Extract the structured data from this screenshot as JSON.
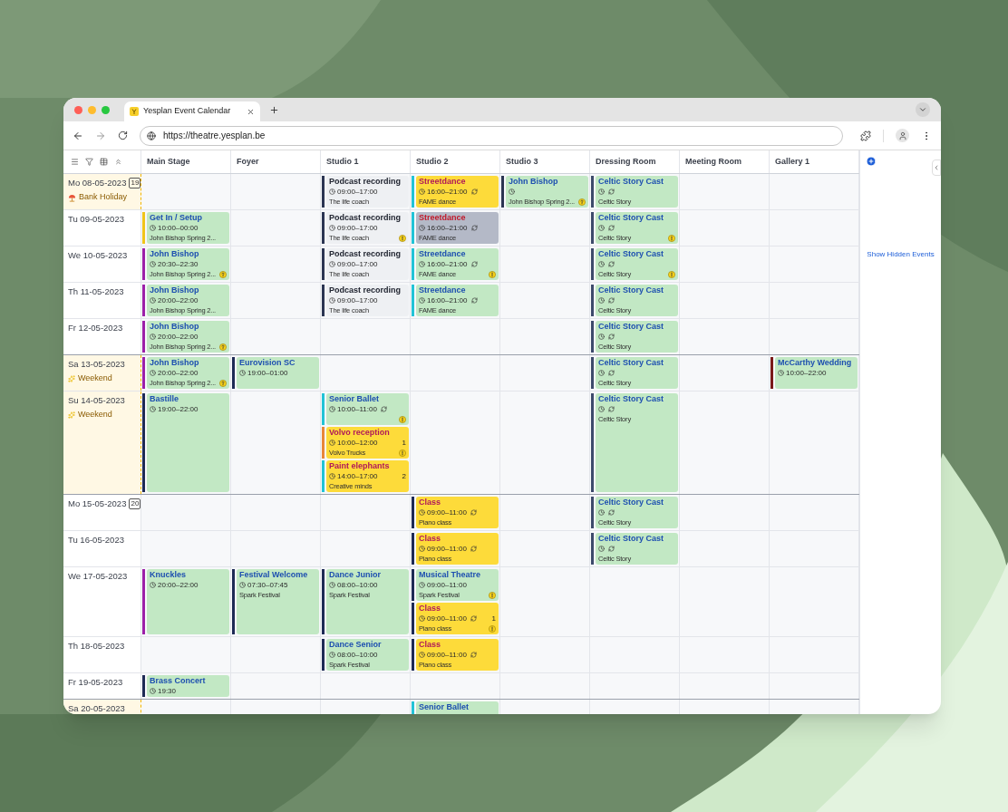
{
  "browser": {
    "tab_title": "Yesplan Event Calendar",
    "url": "https://theatre.yesplan.be"
  },
  "calendar": {
    "columns": [
      "Main Stage",
      "Foyer",
      "Studio 1",
      "Studio 2",
      "Studio 3",
      "Dressing Room",
      "Meeting Room",
      "Gallery 1"
    ],
    "show_hidden": "Show Hidden Events",
    "days": [
      {
        "date": "Mo 08-05-2023",
        "week": "19",
        "kind": "holiday",
        "note": "Bank Holiday",
        "cells": [
          [],
          [],
          [
            {
              "title": "Podcast recording",
              "time": "09:00–17:00",
              "subtitle": "The life coach",
              "kind": "draft",
              "color": "#2b3552",
              "recurring": false,
              "warning": false,
              "question": false
            }
          ],
          [
            {
              "title": "Streetdance",
              "time": "16:00–21:00",
              "subtitle": "FAME dance",
              "kind": "option",
              "color": "#22c3d6",
              "recurring": true,
              "warning": false,
              "question": false
            }
          ],
          [
            {
              "title": "John Bishop",
              "subtitle": "John Bishop Spring 2...",
              "kind": "confirmed",
              "color": "#2b3552",
              "recurring": false,
              "warning": false,
              "question": true
            }
          ],
          [
            {
              "title": "Celtic Story Cast",
              "subtitle": "Celtic Story",
              "kind": "confirmed",
              "color": "#3d4a6b",
              "recurring": true,
              "warning": false,
              "question": false
            }
          ],
          [],
          []
        ]
      },
      {
        "date": "Tu 09-05-2023",
        "kind": "weekday",
        "cells": [
          [
            {
              "title": "Get In / Setup",
              "time": "10:00–00:00",
              "subtitle": "John Bishop Spring 2...",
              "kind": "confirmed",
              "color": "#f0c419",
              "recurring": false,
              "warning": false,
              "question": false
            }
          ],
          [],
          [
            {
              "title": "Podcast recording",
              "time": "09:00–17:00",
              "subtitle": "The life coach",
              "kind": "draft",
              "color": "#2b3552",
              "recurring": false,
              "warning": true,
              "question": false
            }
          ],
          [
            {
              "title": "Streetdance",
              "time": "16:00–21:00",
              "subtitle": "FAME dance",
              "kind": "cancelled",
              "color": "#22c3d6",
              "recurring": true,
              "warning": false,
              "question": false
            }
          ],
          [],
          [
            {
              "title": "Celtic Story Cast",
              "subtitle": "Celtic Story",
              "kind": "confirmed",
              "color": "#3d4a6b",
              "recurring": true,
              "warning": true,
              "question": false
            }
          ],
          [],
          []
        ]
      },
      {
        "date": "We 10-05-2023",
        "kind": "weekday",
        "cells": [
          [
            {
              "title": "John Bishop",
              "time": "20:30–22:30",
              "subtitle": "John Bishop Spring 2...",
              "kind": "confirmed",
              "color": "#9c1fa8",
              "recurring": false,
              "warning": false,
              "question": true
            }
          ],
          [],
          [
            {
              "title": "Podcast recording",
              "time": "09:00–17:00",
              "subtitle": "The life coach",
              "kind": "draft",
              "color": "#2b3552",
              "recurring": false,
              "warning": false,
              "question": false
            }
          ],
          [
            {
              "title": "Streetdance",
              "time": "16:00–21:00",
              "subtitle": "FAME dance",
              "kind": "confirmed",
              "color": "#22c3d6",
              "recurring": true,
              "warning": true,
              "question": false
            }
          ],
          [],
          [
            {
              "title": "Celtic Story Cast",
              "subtitle": "Celtic Story",
              "kind": "confirmed",
              "color": "#3d4a6b",
              "recurring": true,
              "warning": true,
              "question": false
            }
          ],
          [],
          []
        ]
      },
      {
        "date": "Th 11-05-2023",
        "kind": "weekday",
        "cells": [
          [
            {
              "title": "John Bishop",
              "time": "20:00–22:00",
              "subtitle": "John Bishop Spring 2...",
              "kind": "confirmed",
              "color": "#9c1fa8",
              "recurring": false,
              "warning": false,
              "question": false
            }
          ],
          [],
          [
            {
              "title": "Podcast recording",
              "time": "09:00–17:00",
              "subtitle": "The life coach",
              "kind": "draft",
              "color": "#2b3552",
              "recurring": false,
              "warning": false,
              "question": false
            }
          ],
          [
            {
              "title": "Streetdance",
              "time": "16:00–21:00",
              "subtitle": "FAME dance",
              "kind": "confirmed",
              "color": "#22c3d6",
              "recurring": true,
              "warning": false,
              "question": false
            }
          ],
          [],
          [
            {
              "title": "Celtic Story Cast",
              "subtitle": "Celtic Story",
              "kind": "confirmed",
              "color": "#3d4a6b",
              "recurring": true,
              "warning": false,
              "question": false
            }
          ],
          [],
          []
        ]
      },
      {
        "date": "Fr 12-05-2023",
        "kind": "weekday",
        "cells": [
          [
            {
              "title": "John Bishop",
              "time": "20:00–22:00",
              "subtitle": "John Bishop Spring 2...",
              "kind": "confirmed",
              "color": "#9c1fa8",
              "recurring": false,
              "warning": false,
              "question": true
            }
          ],
          [],
          [],
          [],
          [],
          [
            {
              "title": "Celtic Story Cast",
              "subtitle": "Celtic Story",
              "kind": "confirmed",
              "color": "#3d4a6b",
              "recurring": true,
              "warning": false,
              "question": false
            }
          ],
          [],
          []
        ]
      },
      {
        "date": "Sa 13-05-2023",
        "kind": "weekend",
        "note": "Weekend",
        "cells": [
          [
            {
              "title": "John Bishop",
              "time": "20:00–22:00",
              "subtitle": "John Bishop Spring 2...",
              "kind": "confirmed",
              "color": "#9c1fa8",
              "recurring": false,
              "warning": false,
              "question": true
            }
          ],
          [
            {
              "title": "Eurovision SC",
              "time": "19:00–01:00",
              "kind": "confirmed",
              "color": "#1e2a55",
              "recurring": false,
              "warning": false,
              "question": false
            }
          ],
          [],
          [],
          [],
          [
            {
              "title": "Celtic Story Cast",
              "subtitle": "Celtic Story",
              "kind": "confirmed",
              "color": "#3d4a6b",
              "recurring": true,
              "warning": false,
              "question": false
            }
          ],
          [],
          [
            {
              "title": "McCarthy Wedding",
              "time": "10:00–22:00",
              "kind": "confirmed",
              "color": "#7a1a1a",
              "recurring": false,
              "warning": false,
              "question": false
            }
          ]
        ]
      },
      {
        "date": "Su 14-05-2023",
        "kind": "weekend",
        "note": "Weekend",
        "cells": [
          [
            {
              "title": "Bastille",
              "time": "19:00–22:00",
              "kind": "confirmed",
              "color": "#1e2a55",
              "recurring": false,
              "warning": false,
              "question": false
            }
          ],
          [],
          [
            {
              "title": "Senior Ballet",
              "time": "10:00–11:00",
              "kind": "confirmed",
              "color": "#22c3d6",
              "recurring": true,
              "warning": true,
              "question": false
            },
            {
              "title": "Volvo reception",
              "time": "10:00–12:00",
              "subtitle": "Volvo Trucks",
              "kind": "option",
              "color": "#e8873a",
              "recurring": false,
              "count": "1",
              "warning": true,
              "question": false
            },
            {
              "title": "Paint elephants",
              "time": "14:00–17:00",
              "subtitle": "Creative minds",
              "kind": "option",
              "color": "#22c3d6",
              "recurring": false,
              "count": "2",
              "warning": false,
              "question": false
            }
          ],
          [],
          [],
          [
            {
              "title": "Celtic Story Cast",
              "subtitle": "Celtic Story",
              "kind": "confirmed",
              "color": "#3d4a6b",
              "recurring": true,
              "warning": false,
              "question": false
            }
          ],
          [],
          []
        ]
      },
      {
        "date": "Mo 15-05-2023",
        "week": "20",
        "kind": "weekday",
        "cells": [
          [],
          [],
          [],
          [
            {
              "title": "Class",
              "time": "09:00–11:00",
              "subtitle": "Piano class",
              "kind": "option",
              "color": "#1e2a55",
              "recurring": true,
              "warning": false,
              "question": false
            }
          ],
          [],
          [
            {
              "title": "Celtic Story Cast",
              "subtitle": "Celtic Story",
              "kind": "confirmed",
              "color": "#3d4a6b",
              "recurring": true,
              "warning": false,
              "question": false
            }
          ],
          [],
          []
        ]
      },
      {
        "date": "Tu 16-05-2023",
        "kind": "weekday",
        "cells": [
          [],
          [],
          [],
          [
            {
              "title": "Class",
              "time": "09:00–11:00",
              "subtitle": "Piano class",
              "kind": "option",
              "color": "#1e2a55",
              "recurring": true,
              "warning": false,
              "question": false
            }
          ],
          [],
          [
            {
              "title": "Celtic Story Cast",
              "subtitle": "Celtic Story",
              "kind": "confirmed",
              "color": "#3d4a6b",
              "recurring": true,
              "warning": false,
              "question": false
            }
          ],
          [],
          []
        ]
      },
      {
        "date": "We 17-05-2023",
        "kind": "weekday",
        "cells": [
          [
            {
              "title": "Knuckles",
              "time": "20:00–22:00",
              "kind": "confirmed",
              "color": "#9c1fa8",
              "recurring": false,
              "warning": false,
              "question": false
            }
          ],
          [
            {
              "title": "Festival Welcome",
              "time": "07:30–07:45",
              "subtitle": "Spark Festival",
              "kind": "confirmed",
              "color": "#1e2a55",
              "recurring": false,
              "warning": false,
              "question": false
            }
          ],
          [
            {
              "title": "Dance Junior",
              "time": "08:00–10:00",
              "subtitle": "Spark Festival",
              "kind": "confirmed",
              "color": "#1e2a55",
              "recurring": false,
              "warning": false,
              "question": false
            }
          ],
          [
            {
              "title": "Musical Theatre",
              "time": "09:00–11:00",
              "subtitle": "Spark Festival",
              "kind": "confirmed",
              "color": "#1e2a55",
              "recurring": false,
              "warning": true,
              "question": false
            },
            {
              "title": "Class",
              "time": "09:00–11:00",
              "subtitle": "Piano class",
              "kind": "option",
              "color": "#1e2a55",
              "recurring": true,
              "count": "1",
              "warning": true,
              "question": false
            }
          ],
          [],
          [],
          [],
          []
        ]
      },
      {
        "date": "Th 18-05-2023",
        "kind": "weekday",
        "cells": [
          [],
          [],
          [
            {
              "title": "Dance Senior",
              "time": "08:00–10:00",
              "subtitle": "Spark Festival",
              "kind": "confirmed",
              "color": "#1e2a55",
              "recurring": false,
              "warning": false,
              "question": false
            }
          ],
          [
            {
              "title": "Class",
              "time": "09:00–11:00",
              "subtitle": "Piano class",
              "kind": "option",
              "color": "#1e2a55",
              "recurring": true,
              "warning": false,
              "question": false
            }
          ],
          [],
          [],
          [],
          []
        ]
      },
      {
        "date": "Fr 19-05-2023",
        "kind": "weekday",
        "cells": [
          [
            {
              "title": "Brass Concert",
              "time": "19:30",
              "kind": "confirmed",
              "color": "#1e2a55",
              "recurring": false,
              "warning": false,
              "question": false
            }
          ],
          [],
          [],
          [],
          [],
          [],
          [],
          []
        ]
      },
      {
        "date": "Sa 20-05-2023",
        "kind": "weekend",
        "cells": [
          [],
          [],
          [],
          [
            {
              "title": "Senior Ballet",
              "kind": "confirmed",
              "color": "#22c3d6",
              "recurring": false,
              "warning": false,
              "question": false
            }
          ],
          [],
          [],
          [],
          []
        ]
      }
    ]
  }
}
